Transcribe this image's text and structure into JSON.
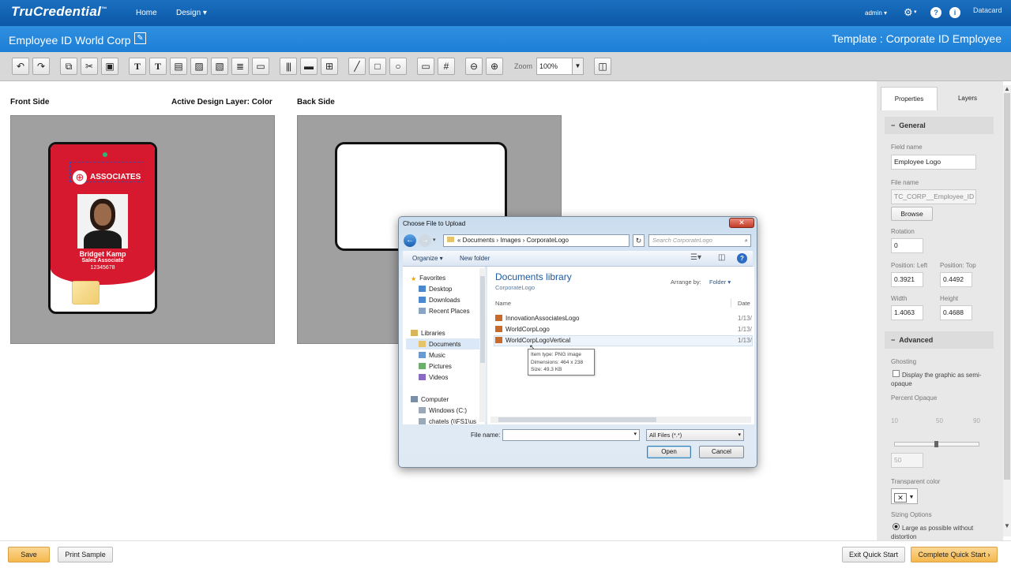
{
  "topnav": {
    "logo": "TruCredential",
    "logo_tm": "™",
    "links": [
      "Home",
      "Design ▾"
    ],
    "user": "admin ▾",
    "brand": "Datacard"
  },
  "titlebar": {
    "card_name": "Employee ID World Corp",
    "template": "Template : Corporate ID Employee"
  },
  "toolbar": {
    "zoom_label": "Zoom",
    "zoom_value": "100%"
  },
  "workspace": {
    "front_label": "Front Side",
    "active_layer": "Active Design Layer: Color",
    "back_label": "Back Side",
    "badge": {
      "company": "ASSOCIATES",
      "name": "Bridget Kamp",
      "title": "Sales Associate",
      "id": "12345678"
    }
  },
  "sidebar": {
    "tabs": [
      "Properties",
      "Layers"
    ],
    "general": "General",
    "field_name_label": "Field name",
    "field_name": "Employee Logo",
    "file_name_label": "File name",
    "file_name": "TC_CORP__Employee_ID",
    "browse": "Browse",
    "rotation_label": "Rotation",
    "rotation": "0",
    "pos_left_label": "Position: Left",
    "pos_left": "0.3921",
    "pos_top_label": "Position: Top",
    "pos_top": "0.4492",
    "width_label": "Width",
    "width": "1.4063",
    "height_label": "Height",
    "height": "0.4688",
    "advanced": "Advanced",
    "ghosting_label": "Ghosting",
    "ghosting_check": "Display the graphic as semi-opaque",
    "percent_label": "Percent Opaque",
    "ticks": [
      "10",
      "50",
      "90"
    ],
    "percent_value": "50",
    "transparent_label": "Transparent color",
    "sizing_label": "Sizing Options",
    "sizing_option": "Large as possible without distortion"
  },
  "footer": {
    "save": "Save",
    "print_sample": "Print Sample",
    "exit": "Exit Quick Start",
    "complete": "Complete Quick Start"
  },
  "dialog": {
    "title": "Choose File to Upload",
    "close": "✕",
    "breadcrumb": "« Documents › Images › CorporateLogo",
    "search_placeholder": "Search CorporateLogo",
    "organize": "Organize ▾",
    "new_folder": "New folder",
    "library_title": "Documents library",
    "library_sub": "CorporateLogo",
    "arrange_by": "Arrange by:",
    "arrange_value": "Folder ▾",
    "col_name": "Name",
    "col_date": "Date",
    "nav": {
      "favorites": "Favorites",
      "fav_items": [
        "Desktop",
        "Downloads",
        "Recent Places"
      ],
      "libraries": "Libraries",
      "lib_items": [
        "Documents",
        "Music",
        "Pictures",
        "Videos"
      ],
      "computer": "Computer",
      "comp_items": [
        "Windows (C:)",
        "chatels (\\\\FS1\\us"
      ]
    },
    "files": [
      {
        "name": "InnovationAssociatesLogo",
        "date": "1/13/"
      },
      {
        "name": "WorldCorpLogo",
        "date": "1/13/"
      },
      {
        "name": "WorldCorpLogoVertical",
        "date": "1/13/"
      }
    ],
    "tooltip": [
      "Item type: PNG image",
      "Dimensions: 464 x 238",
      "Size: 49.3 KB"
    ],
    "file_name_label": "File name:",
    "filter": "All Files (*.*)",
    "open": "Open",
    "cancel": "Cancel"
  },
  "colors": {
    "nav_blue": "#0b58a6",
    "title_blue": "#1d7fd6",
    "badge_red": "#d7192f",
    "button_orange": "#f5c26b"
  }
}
